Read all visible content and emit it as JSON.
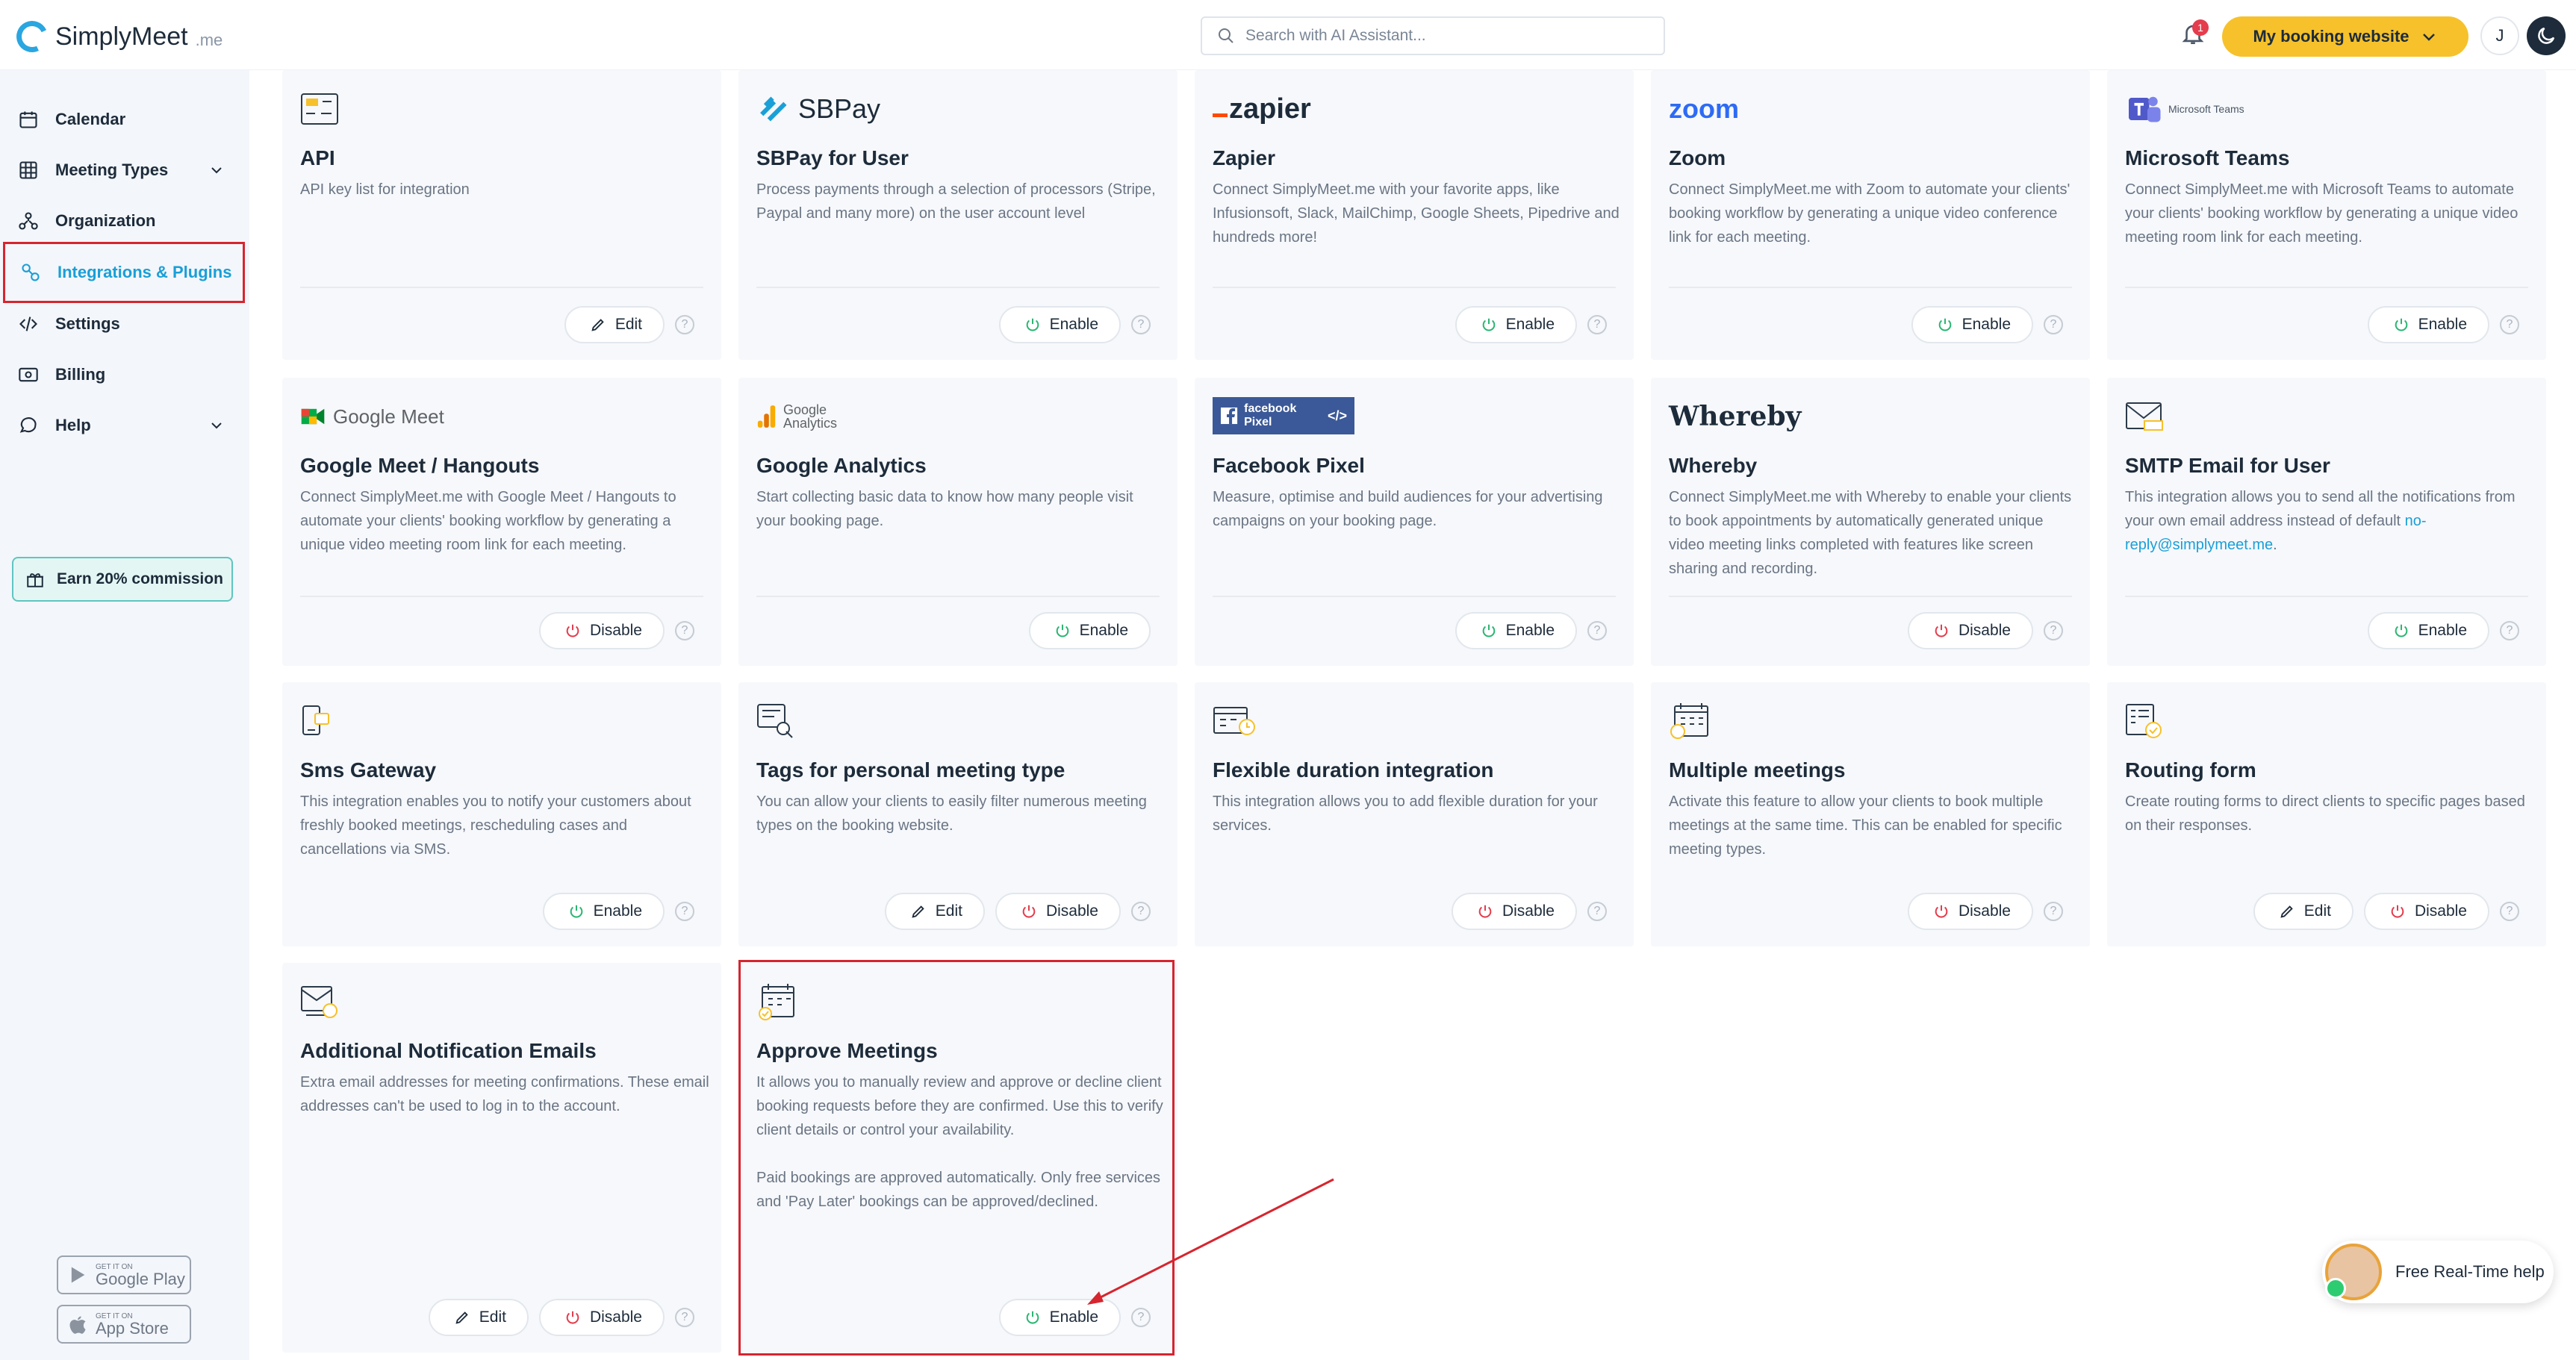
{
  "header": {
    "logo_main": "SimplyMeet",
    "logo_suffix": ".me",
    "search_placeholder": "Search with AI Assistant...",
    "notification_count": "1",
    "booking_button": "My booking website",
    "user_initial": "J"
  },
  "sidebar": {
    "items": [
      {
        "label": "Calendar",
        "icon": "calendar-icon"
      },
      {
        "label": "Meeting Types",
        "icon": "grid-icon",
        "has_chevron": true
      },
      {
        "label": "Organization",
        "icon": "org-icon"
      },
      {
        "label": "Integrations & Plugins",
        "icon": "plug-icon",
        "active": true
      },
      {
        "label": "Settings",
        "icon": "code-icon"
      },
      {
        "label": "Billing",
        "icon": "card-icon"
      },
      {
        "label": "Help",
        "icon": "chat-icon",
        "has_chevron": true
      }
    ],
    "earn_label": "Earn 20% commission",
    "google_play_small": "GET IT ON",
    "google_play_label": "Google Play",
    "app_store_small": "GET IT ON",
    "app_store_label": "App Store"
  },
  "logos": {
    "sbpay": "SBPay",
    "zapier": "zapier",
    "zoom": "zoom",
    "teams": "Microsoft Teams",
    "google_meet": "Google Meet",
    "google_analytics_1": "Google",
    "google_analytics_2": "Analytics",
    "facebook_pixel": "facebook Pixel",
    "whereby": "Whereby"
  },
  "integrations": [
    {
      "title": "API",
      "desc": "API key list for integration",
      "buttons": [
        "Edit"
      ]
    },
    {
      "title": "SBPay for User",
      "desc": "Process payments through a selection of processors (Stripe, Paypal and many more) on the user account level",
      "buttons": [
        "Enable"
      ]
    },
    {
      "title": "Zapier",
      "desc": "Connect SimplyMeet.me with your favorite apps, like Infusionsoft, Slack, MailChimp, Google Sheets, Pipedrive and hundreds more!",
      "buttons": [
        "Enable"
      ]
    },
    {
      "title": "Zoom",
      "desc": "Connect SimplyMeet.me with Zoom to automate your clients' booking workflow by generating a unique video conference link for each meeting.",
      "buttons": [
        "Enable"
      ]
    },
    {
      "title": "Microsoft Teams",
      "desc": "Connect SimplyMeet.me with Microsoft Teams to automate your clients' booking workflow by generating a unique video meeting room link for each meeting.",
      "buttons": [
        "Enable"
      ]
    },
    {
      "title": "Google Meet / Hangouts",
      "desc": "Connect SimplyMeet.me with Google Meet / Hangouts to automate your clients' booking workflow by generating a unique video meeting room link for each meeting.",
      "buttons": [
        "Disable"
      ]
    },
    {
      "title": "Google Analytics",
      "desc": "Start collecting basic data to know how many people visit your booking page.",
      "buttons": [
        "Enable"
      ]
    },
    {
      "title": "Facebook Pixel",
      "desc": "Measure, optimise and build audiences for your advertising campaigns on your booking page.",
      "buttons": [
        "Enable"
      ]
    },
    {
      "title": "Whereby",
      "desc": "Connect SimplyMeet.me with Whereby to enable your clients to book appointments by automatically generated unique video meeting links completed with features like screen sharing and recording.",
      "buttons": [
        "Disable"
      ]
    },
    {
      "title": "SMTP Email for User",
      "desc": "This integration allows you to send all the notifications from your own email address instead of default",
      "desc_link": "no-reply@simplymeet.me",
      "desc_end": ".",
      "buttons": [
        "Enable"
      ]
    },
    {
      "title": "Sms Gateway",
      "desc": "This integration enables you to notify your customers about freshly booked meetings, rescheduling cases and cancellations via SMS.",
      "buttons": [
        "Enable"
      ]
    },
    {
      "title": "Tags for personal meeting type",
      "desc": "You can allow your clients to easily filter numerous meeting types on the booking website.",
      "buttons": [
        "Edit",
        "Disable"
      ]
    },
    {
      "title": "Flexible duration integration",
      "desc": "This integration allows you to add flexible duration for your services.",
      "buttons": [
        "Disable"
      ]
    },
    {
      "title": "Multiple meetings",
      "desc": "Activate this feature to allow your clients to book multiple meetings at the same time. This can be enabled for specific meeting types.",
      "buttons": [
        "Disable"
      ]
    },
    {
      "title": "Routing form",
      "desc": "Create routing forms to direct clients to specific pages based on their responses.",
      "buttons": [
        "Edit",
        "Disable"
      ]
    },
    {
      "title": "Additional Notification Emails",
      "desc": "Extra email addresses for meeting confirmations. These email addresses can't be used to log in to the account.",
      "buttons": [
        "Edit",
        "Disable"
      ]
    },
    {
      "title": "Approve Meetings",
      "desc": "It allows you to manually review and approve or decline client booking requests before they are confirmed. Use this to verify client details or control your availability.\n\nPaid bookings are approved automatically. Only free services and 'Pay Later' bookings can be approved/declined.",
      "buttons": [
        "Enable"
      ]
    }
  ],
  "help_widget": "Free Real-Time help",
  "help_q": "?",
  "colors": {
    "accent": "#1a9fd7",
    "brand_yellow": "#f6c12a",
    "enable_green": "#2bb673",
    "disable_red": "#e43d4d",
    "highlight_red": "#d6252f"
  }
}
